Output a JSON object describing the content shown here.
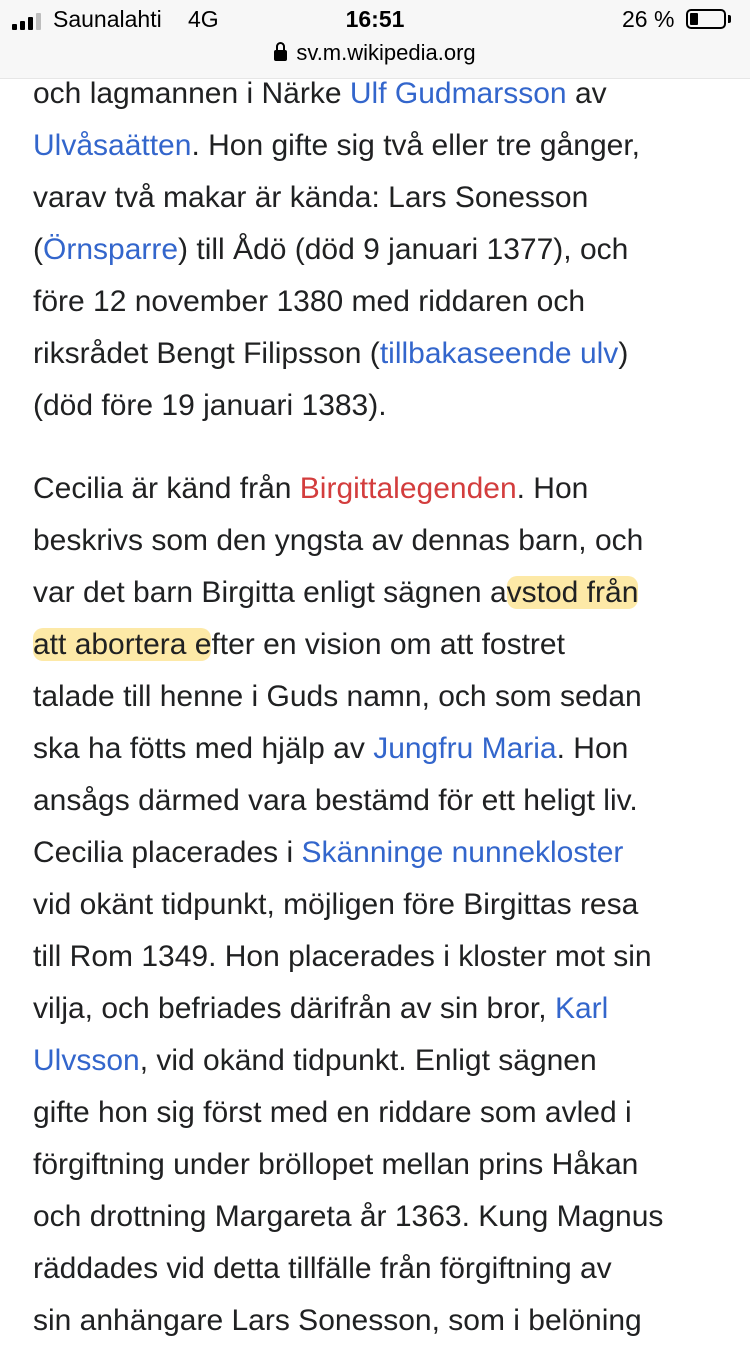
{
  "status_bar": {
    "carrier": "Saunalahti",
    "network": "4G",
    "time": "16:51",
    "battery_text": "26 %",
    "battery_level": 0.26,
    "signal_bars": 3,
    "signal_bars_max": 4
  },
  "address_bar": {
    "domain": "sv.m.wikipedia.org"
  },
  "colors": {
    "link": "#3366cc",
    "redlink": "#d33d3d",
    "highlight": "#fde9a7"
  },
  "article": {
    "paragraphs": [
      {
        "lines": [
          [
            {
              "t": "och lagmannen i Närke "
            },
            {
              "t": "Ulf Gudmarsson",
              "k": "link"
            },
            {
              "t": " av"
            }
          ],
          [
            {
              "t": "Ulvåsaätten",
              "k": "link"
            },
            {
              "t": ". Hon gifte sig två eller tre gånger,"
            }
          ],
          [
            {
              "t": "varav två makar är kända: Lars Sonesson"
            }
          ],
          [
            {
              "t": "("
            },
            {
              "t": "Örnsparre",
              "k": "link"
            },
            {
              "t": ") till Ådö (död 9 januari 1377), och"
            }
          ],
          [
            {
              "t": "före 12 november 1380 med riddaren och"
            }
          ],
          [
            {
              "t": "riksrådet Bengt Filipsson ("
            },
            {
              "t": "tillbakaseende ulv",
              "k": "link"
            },
            {
              "t": ")"
            }
          ],
          [
            {
              "t": "(död före 19 januari 1383)."
            }
          ]
        ]
      },
      {
        "lines": [
          [
            {
              "t": "Cecilia är känd från "
            },
            {
              "t": "Birgittalegenden",
              "k": "redlink"
            },
            {
              "t": ". Hon"
            }
          ],
          [
            {
              "t": "beskrivs som den yngsta av dennas barn, och"
            }
          ],
          [
            {
              "t": "var det barn Birgitta enligt sägnen a"
            },
            {
              "t": "vstod från",
              "k": "hl"
            }
          ],
          [
            {
              "t": "att abortera e",
              "k": "hl"
            },
            {
              "t": "fter en vision om att fostret"
            }
          ],
          [
            {
              "t": "talade till henne i Guds namn, och som sedan"
            }
          ],
          [
            {
              "t": "ska ha fötts med hjälp av "
            },
            {
              "t": "Jungfru Maria",
              "k": "link"
            },
            {
              "t": ". Hon"
            }
          ],
          [
            {
              "t": "ansågs därmed vara bestämd för ett heligt liv."
            }
          ],
          [
            {
              "t": "Cecilia placerades i "
            },
            {
              "t": "Skänninge nunnekloster",
              "k": "link"
            }
          ],
          [
            {
              "t": "vid okänt tidpunkt, möjligen före Birgittas resa"
            }
          ],
          [
            {
              "t": "till Rom 1349. Hon placerades i kloster mot sin"
            }
          ],
          [
            {
              "t": "vilja, och befriades därifrån av sin bror, "
            },
            {
              "t": "Karl",
              "k": "link"
            }
          ],
          [
            {
              "t": "Ulvsson",
              "k": "link"
            },
            {
              "t": ", vid okänd tidpunkt. Enligt sägnen"
            }
          ],
          [
            {
              "t": "gifte hon sig först med en riddare som avled i"
            }
          ],
          [
            {
              "t": "förgiftning under bröllopet mellan prins Håkan"
            }
          ],
          [
            {
              "t": "och drottning Margareta år 1363. Kung Magnus"
            }
          ],
          [
            {
              "t": "räddades vid detta tillfälle från förgiftning av"
            }
          ],
          [
            {
              "t": "sin anhängare Lars Sonesson, som i belöning"
            }
          ]
        ]
      }
    ]
  }
}
